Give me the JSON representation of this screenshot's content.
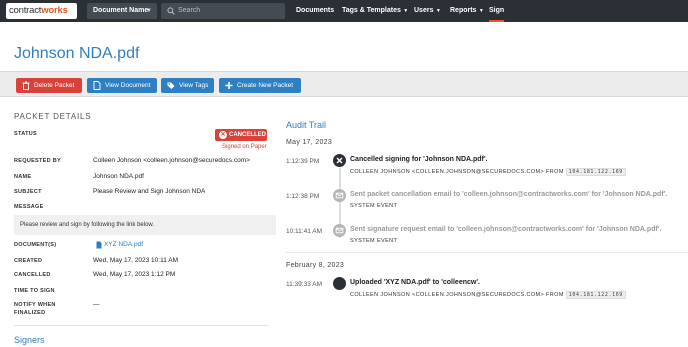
{
  "navbar": {
    "logo_part1": "contract",
    "logo_part2": "works",
    "document_name_label": "Document Name",
    "search_placeholder": "Search",
    "items": [
      {
        "label": "Documents"
      },
      {
        "label": "Tags & Templates"
      },
      {
        "label": "Users"
      },
      {
        "label": "Reports"
      },
      {
        "label": "Sign"
      }
    ]
  },
  "page": {
    "title": "Johnson NDA.pdf"
  },
  "toolbar": {
    "delete_label": "Delete Packet",
    "view_document_label": "View Document",
    "view_tags_label": "View Tags",
    "new_packet_label": "Create New Packet"
  },
  "packet": {
    "section_title": "PACKET DETAILS",
    "status_label": "STATUS",
    "status_badge": "CANCELLED",
    "signed_on_paper": "Signed on Paper",
    "requested_by_label": "REQUESTED BY",
    "requested_by": "Colleen Johnson <colleen.johnson@securedocs.com>",
    "name_label": "NAME",
    "name": "Johnson NDA.pdf",
    "subject_label": "SUBJECT",
    "subject": "Please Review and Sign Johnson NDA",
    "message_label": "MESSAGE",
    "message": "Please review and sign by following the link below.",
    "documents_label": "DOCUMENT(S)",
    "document": "XYZ NDA.pdf",
    "created_label": "CREATED",
    "created": "Wed, May 17, 2023 10:11 AM",
    "cancelled_label": "CANCELLED",
    "cancelled": "Wed, May 17, 2023 1:12 PM",
    "time_to_sign_label": "TIME TO SIGN",
    "notify_label_1": "NOTIFY WHEN",
    "notify_label_2": "FINALIZED",
    "notify_value": "—",
    "signers_title": "Signers"
  },
  "audit": {
    "title": "Audit Trail",
    "groups": [
      {
        "date": "May 17, 2023",
        "events": [
          {
            "time": "1:12:39 PM",
            "main": "Cancelled signing for 'Johnson NDA.pdf'.",
            "sub": "COLLEEN JOHNSON <COLLEEN.JOHNSON@SECUREDOCS.COM> FROM",
            "ip": "104.181.122.169",
            "icon": "cancel-icon"
          },
          {
            "time": "1:12:38 PM",
            "main": "Sent packet cancellation email to 'colleen.johnson@contractworks.com' for 'Johnson NDA.pdf'.",
            "sub": "SYSTEM EVENT",
            "icon": "email-icon"
          },
          {
            "time": "10:11:41 AM",
            "main": "Sent signature request email to 'colleen.johnson@contractworks.com' for 'Johnson NDA.pdf'.",
            "sub": "SYSTEM EVENT",
            "icon": "email-icon"
          }
        ]
      },
      {
        "date": "February 8, 2023",
        "events": [
          {
            "time": "11:39:33 AM",
            "main": "Uploaded 'XYZ NDA.pdf' to 'colleencw'.",
            "sub": "COLLEEN JOHNSON <COLLEEN.JOHNSON@SECUREDOCS.COM> FROM",
            "ip": "104.181.122.169",
            "icon": "upload-dot-icon"
          }
        ]
      }
    ]
  },
  "colors": {
    "accent_blue": "#2f80c2",
    "danger_red": "#d9423b",
    "nav_bg": "#2b3036",
    "brand_orange": "#e8562a"
  }
}
